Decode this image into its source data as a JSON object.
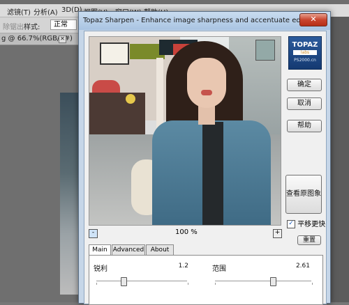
{
  "photoshop": {
    "menu": [
      "滤镜(T)",
      "分析(A)",
      "3D(D)",
      "视图(V)",
      "窗口(W)",
      "帮助(H)"
    ],
    "options": {
      "left_label": "除锯出",
      "style_label": "样式:",
      "style_value": "正常"
    },
    "doc_tab": {
      "label": "g @ 66.7%(RGB/8#)",
      "close": "✕"
    }
  },
  "dialog": {
    "title": "Topaz Sharpen - Enhance image sharpness and accentuate edges",
    "close": "✕",
    "logo": {
      "line1": "TOPAZ",
      "line2": "labs",
      "line3": "PS2000.cn"
    },
    "buttons": {
      "ok": "确定",
      "cancel": "取消",
      "help": "帮助",
      "view_original": "查看原图象",
      "reset": "重置"
    },
    "pan_checkbox": {
      "label": "平移更快",
      "checked": true,
      "mark": "✓"
    },
    "zoom": {
      "minus": "-",
      "plus": "+",
      "value": "100 %"
    },
    "tabs": [
      {
        "label": "Main",
        "active": true
      },
      {
        "label": "Advanced"
      },
      {
        "label": "About"
      }
    ],
    "params": [
      {
        "label": "锐利",
        "value": "1.2",
        "slider_fraction": 0.3
      },
      {
        "label": "范围",
        "value": "2.61",
        "slider_fraction": 0.6
      }
    ]
  }
}
